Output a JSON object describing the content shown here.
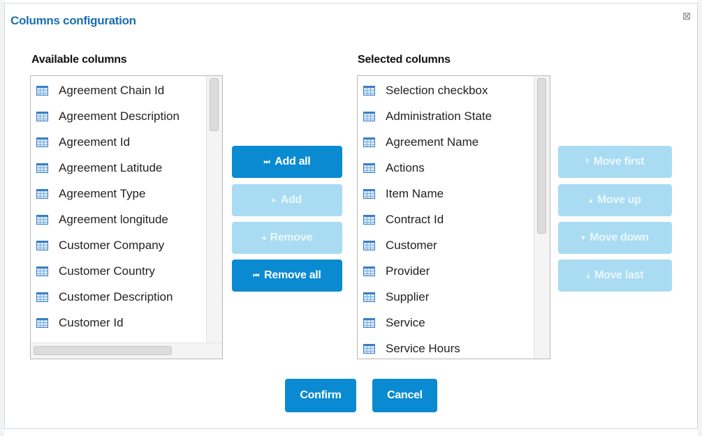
{
  "dialog": {
    "title": "Columns configuration",
    "close_glyph": "⊠"
  },
  "available": {
    "label": "Available columns",
    "items": [
      "Agreement Chain Id",
      "Agreement Description",
      "Agreement Id",
      "Agreement Latitude",
      "Agreement Type",
      "Agreement longitude",
      "Customer Company",
      "Customer Country",
      "Customer Description",
      "Customer Id"
    ]
  },
  "selected": {
    "label": "Selected columns",
    "items": [
      "Selection checkbox",
      "Administration State",
      "Agreement Name",
      "Actions",
      "Item Name",
      "Contract Id",
      "Customer",
      "Provider",
      "Supplier",
      "Service",
      "Service Hours"
    ]
  },
  "transfer_buttons": {
    "add_all": {
      "icon": "⏭",
      "label": "Add all",
      "state": "enabled"
    },
    "add": {
      "icon": "▸",
      "label": "Add",
      "state": "disabled"
    },
    "remove": {
      "icon": "◂",
      "label": "Remove",
      "state": "disabled"
    },
    "remove_all": {
      "icon": "⏮",
      "label": "Remove all",
      "state": "enabled"
    }
  },
  "order_buttons": {
    "move_first": {
      "icon": "⤒",
      "label": "Move first",
      "state": "disabled"
    },
    "move_up": {
      "icon": "▴",
      "label": "Move up",
      "state": "disabled"
    },
    "move_down": {
      "icon": "▾",
      "label": "Move down",
      "state": "disabled"
    },
    "move_last": {
      "icon": "⤓",
      "label": "Move last",
      "state": "disabled"
    }
  },
  "footer": {
    "confirm_label": "Confirm",
    "cancel_label": "Cancel"
  },
  "colors": {
    "accent": "#0a8bd1",
    "accent_disabled": "#a9dcf3",
    "title": "#1a6fb0"
  },
  "icons": {
    "list_item_icon": "table-icon"
  }
}
